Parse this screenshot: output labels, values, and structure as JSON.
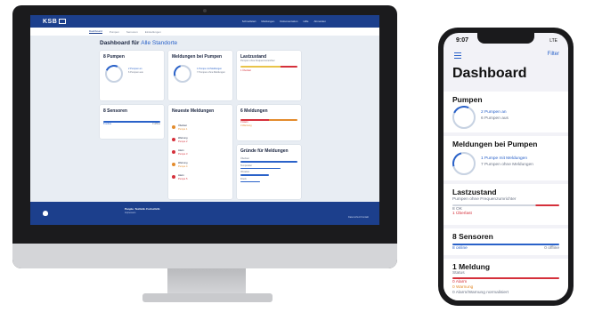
{
  "desktop": {
    "logo": "KSB",
    "top_nav": [
      "Schnellstart",
      "Meldungen",
      "Dokumentation",
      "Hilfe",
      "Abmelden"
    ],
    "sub_nav": [
      "Dashboard",
      "Pumpen",
      "Sensoren",
      "Einstellungen"
    ],
    "heading": "Dashboard für",
    "heading_link": "Alle Standorte",
    "cards": {
      "pumps": {
        "title": "8 Pumpen",
        "line1": "2 Pumpen an",
        "line2": "6 Pumpen aus"
      },
      "pump_messages": {
        "title": "Meldungen bei Pumpen",
        "line1": "1 Pumpe mit Meldungen",
        "line2": "7 Pumpen ohne Meldungen"
      },
      "load": {
        "title": "Lastzustand",
        "line1": "Pumpen ohne Frequenzumrichter",
        "line2": "1 Überlast"
      },
      "sensors": {
        "title": "8 Sensoren",
        "line1": "8 online",
        "line2": "0 offline"
      },
      "recent": {
        "title": "Neueste Meldungen",
        "items": [
          {
            "title": "Überlast",
            "sub": "Pumpe 1"
          },
          {
            "title": "Warnung",
            "sub": "Pumpe 2"
          },
          {
            "title": "Alarm",
            "sub": "Pumpe 3"
          },
          {
            "title": "Warnung",
            "sub": "Pumpe 4"
          },
          {
            "title": "Alarm",
            "sub": "Pumpe 5"
          }
        ]
      },
      "messages": {
        "title": "6 Meldungen",
        "line1": "3 Alarm",
        "line2": "3 Warnung"
      },
      "reasons": {
        "title": "Gründe für Meldungen",
        "lines": [
          "Überlast",
          "Temperatur",
          "Vibration",
          "Druck"
        ]
      }
    },
    "footer": {
      "title": "People. Technik. Fortschritt.",
      "sub": "Impressum",
      "links": "Datenschutz  Kontakt"
    }
  },
  "phone": {
    "time": "9:07",
    "status_right": "LTE",
    "filter": "Filter",
    "title": "Dashboard",
    "pumps": {
      "title": "Pumpen",
      "on": "2 Pumpen an",
      "off": "6 Pumpen aus"
    },
    "pump_messages": {
      "title": "Meldungen bei Pumpen",
      "with": "1 Pumpe mit Meldungen",
      "without": "7 Pumpen ohne Meldungen"
    },
    "load": {
      "title": "Lastzustand",
      "subtitle": "Pumpen ohne Frequenzumrichter",
      "line1": "8 OK",
      "line2": "1 Überlast"
    },
    "sensors": {
      "title": "8 Sensoren",
      "online": "8 online",
      "offline": "0 offline"
    },
    "messages": {
      "title": "1 Meldung",
      "status": "Status",
      "alarm": "0 Alarm",
      "warning": "0 Warnung",
      "normal": "0 Alarm/Warnung normalisiert"
    }
  },
  "colors": {
    "brand": "#1c3f8c",
    "accent": "#2a62c9",
    "alarm": "#d5303b",
    "warning": "#e38b2c"
  }
}
